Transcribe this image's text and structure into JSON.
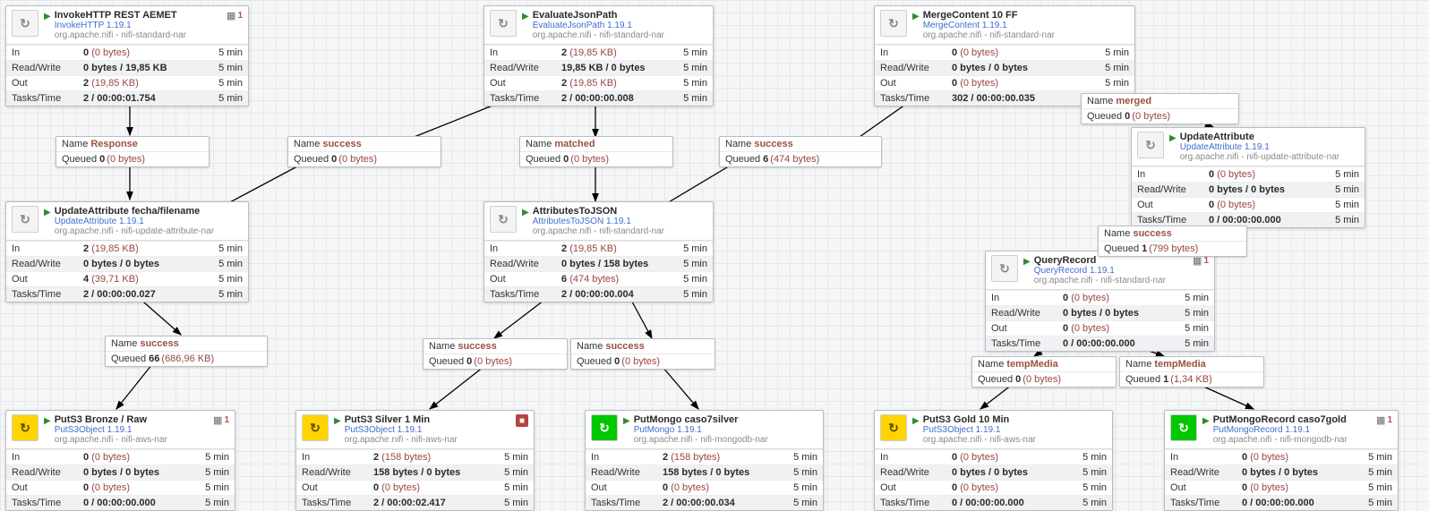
{
  "procs": {
    "invokehttp": {
      "title": "InvokeHTTP REST AEMET",
      "sub": "InvokeHTTP 1.19.1",
      "bundle": "org.apache.nifi - nifi-standard-nar",
      "pgrp": "1",
      "in": {
        "p": "0",
        "s": "(0 bytes)",
        "r": "5 min"
      },
      "rw": {
        "p": "0 bytes / 19,85 KB",
        "s": "",
        "r": "5 min"
      },
      "out": {
        "p": "2",
        "s": "(19,85 KB)",
        "r": "5 min"
      },
      "tt": {
        "p": "2 / 00:00:01.754",
        "s": "",
        "r": "5 min"
      }
    },
    "evaljson": {
      "title": "EvaluateJsonPath",
      "sub": "EvaluateJsonPath 1.19.1",
      "bundle": "org.apache.nifi - nifi-standard-nar",
      "in": {
        "p": "2",
        "s": "(19,85 KB)",
        "r": "5 min"
      },
      "rw": {
        "p": "19,85 KB / 0 bytes",
        "s": "",
        "r": "5 min"
      },
      "out": {
        "p": "2",
        "s": "(19,85 KB)",
        "r": "5 min"
      },
      "tt": {
        "p": "2 / 00:00:00.008",
        "s": "",
        "r": "5 min"
      }
    },
    "merge": {
      "title": "MergeContent 10 FF",
      "sub": "MergeContent 1.19.1",
      "bundle": "org.apache.nifi - nifi-standard-nar",
      "in": {
        "p": "0",
        "s": "(0 bytes)",
        "r": "5 min"
      },
      "rw": {
        "p": "0 bytes / 0 bytes",
        "s": "",
        "r": "5 min"
      },
      "out": {
        "p": "0",
        "s": "(0 bytes)",
        "r": "5 min"
      },
      "tt": {
        "p": "302 / 00:00:00.035",
        "s": "",
        "r": "5 min"
      }
    },
    "updattr_fecha": {
      "title": "UpdateAttribute fecha/filename",
      "sub": "UpdateAttribute 1.19.1",
      "bundle": "org.apache.nifi - nifi-update-attribute-nar",
      "in": {
        "p": "2",
        "s": "(19,85 KB)",
        "r": "5 min"
      },
      "rw": {
        "p": "0 bytes / 0 bytes",
        "s": "",
        "r": "5 min"
      },
      "out": {
        "p": "4",
        "s": "(39,71 KB)",
        "r": "5 min"
      },
      "tt": {
        "p": "2 / 00:00:00.027",
        "s": "",
        "r": "5 min"
      }
    },
    "attrtojson": {
      "title": "AttributesToJSON",
      "sub": "AttributesToJSON 1.19.1",
      "bundle": "org.apache.nifi - nifi-standard-nar",
      "in": {
        "p": "2",
        "s": "(19,85 KB)",
        "r": "5 min"
      },
      "rw": {
        "p": "0 bytes / 158 bytes",
        "s": "",
        "r": "5 min"
      },
      "out": {
        "p": "6",
        "s": "(474 bytes)",
        "r": "5 min"
      },
      "tt": {
        "p": "2 / 00:00:00.004",
        "s": "",
        "r": "5 min"
      }
    },
    "updattr_r": {
      "title": "UpdateAttribute",
      "sub": "UpdateAttribute 1.19.1",
      "bundle": "org.apache.nifi - nifi-update-attribute-nar",
      "in": {
        "p": "0",
        "s": "(0 bytes)",
        "r": "5 min"
      },
      "rw": {
        "p": "0 bytes / 0 bytes",
        "s": "",
        "r": "5 min"
      },
      "out": {
        "p": "0",
        "s": "(0 bytes)",
        "r": "5 min"
      },
      "tt": {
        "p": "0 / 00:00:00.000",
        "s": "",
        "r": "5 min"
      }
    },
    "queryrec": {
      "title": "QueryRecord",
      "sub": "QueryRecord 1.19.1",
      "bundle": "org.apache.nifi - nifi-standard-nar",
      "pgrp": "1",
      "in": {
        "p": "0",
        "s": "(0 bytes)",
        "r": "5 min"
      },
      "rw": {
        "p": "0 bytes / 0 bytes",
        "s": "",
        "r": "5 min"
      },
      "out": {
        "p": "0",
        "s": "(0 bytes)",
        "r": "5 min"
      },
      "tt": {
        "p": "0 / 00:00:00.000",
        "s": "",
        "r": "5 min"
      }
    },
    "puts3bronze": {
      "title": "PutS3 Bronze / Raw",
      "sub": "PutS3Object 1.19.1",
      "bundle": "org.apache.nifi - nifi-aws-nar",
      "pgrp": "1",
      "icon": "yellow",
      "in": {
        "p": "0",
        "s": "(0 bytes)",
        "r": "5 min"
      },
      "rw": {
        "p": "0 bytes / 0 bytes",
        "s": "",
        "r": "5 min"
      },
      "out": {
        "p": "0",
        "s": "(0 bytes)",
        "r": "5 min"
      },
      "tt": {
        "p": "0 / 00:00:00.000",
        "s": "",
        "r": "5 min"
      }
    },
    "puts3silver": {
      "title": "PutS3 Silver 1 Min",
      "sub": "PutS3Object 1.19.1",
      "bundle": "org.apache.nifi - nifi-aws-nar",
      "icon": "yellow",
      "alert": true,
      "in": {
        "p": "2",
        "s": "(158 bytes)",
        "r": "5 min"
      },
      "rw": {
        "p": "158 bytes / 0 bytes",
        "s": "",
        "r": "5 min"
      },
      "out": {
        "p": "0",
        "s": "(0 bytes)",
        "r": "5 min"
      },
      "tt": {
        "p": "2 / 00:00:02.417",
        "s": "",
        "r": "5 min"
      }
    },
    "putmongo7s": {
      "title": "PutMongo caso7silver",
      "sub": "PutMongo 1.19.1",
      "bundle": "org.apache.nifi - nifi-mongodb-nar",
      "icon": "green",
      "in": {
        "p": "2",
        "s": "(158 bytes)",
        "r": "5 min"
      },
      "rw": {
        "p": "158 bytes / 0 bytes",
        "s": "",
        "r": "5 min"
      },
      "out": {
        "p": "0",
        "s": "(0 bytes)",
        "r": "5 min"
      },
      "tt": {
        "p": "2 / 00:00:00.034",
        "s": "",
        "r": "5 min"
      }
    },
    "puts3gold": {
      "title": "PutS3 Gold 10 Min",
      "sub": "PutS3Object 1.19.1",
      "bundle": "org.apache.nifi - nifi-aws-nar",
      "icon": "yellow",
      "in": {
        "p": "0",
        "s": "(0 bytes)",
        "r": "5 min"
      },
      "rw": {
        "p": "0 bytes / 0 bytes",
        "s": "",
        "r": "5 min"
      },
      "out": {
        "p": "0",
        "s": "(0 bytes)",
        "r": "5 min"
      },
      "tt": {
        "p": "0 / 00:00:00.000",
        "s": "",
        "r": "5 min"
      }
    },
    "putmongorec": {
      "title": "PutMongoRecord caso7gold",
      "sub": "PutMongoRecord 1.19.1",
      "bundle": "org.apache.nifi - nifi-mongodb-nar",
      "pgrp": "1",
      "icon": "green",
      "in": {
        "p": "0",
        "s": "(0 bytes)",
        "r": "5 min"
      },
      "rw": {
        "p": "0 bytes / 0 bytes",
        "s": "",
        "r": "5 min"
      },
      "out": {
        "p": "0",
        "s": "(0 bytes)",
        "r": "5 min"
      },
      "tt": {
        "p": "0 / 00:00:00.000",
        "s": "",
        "r": "5 min"
      }
    }
  },
  "conns": {
    "response": {
      "name": "Response",
      "q": "0",
      "qs": "(0 bytes)"
    },
    "success_small": {
      "name": "success",
      "q": "0",
      "qs": "(0 bytes)"
    },
    "matched": {
      "name": "matched",
      "q": "0",
      "qs": "(0 bytes)"
    },
    "success6": {
      "name": "success",
      "q": "6",
      "qs": "(474 bytes)"
    },
    "merged": {
      "name": "merged",
      "q": "0",
      "qs": "(0 bytes)"
    },
    "success66": {
      "name": "success",
      "q": "66",
      "qs": "(686,96 KB)"
    },
    "succA": {
      "name": "success",
      "q": "0",
      "qs": "(0 bytes)"
    },
    "succB": {
      "name": "success",
      "q": "0",
      "qs": "(0 bytes)"
    },
    "succ1": {
      "name": "success",
      "q": "1",
      "qs": "(799 bytes)"
    },
    "tmA": {
      "name": "tempMedia",
      "q": "0",
      "qs": "(0 bytes)"
    },
    "tmB": {
      "name": "tempMedia",
      "q": "1",
      "qs": "(1,34 KB)"
    }
  },
  "labels": {
    "name": "Name",
    "queued": "Queued",
    "in": "In",
    "rw": "Read/Write",
    "out": "Out",
    "tt": "Tasks/Time"
  }
}
